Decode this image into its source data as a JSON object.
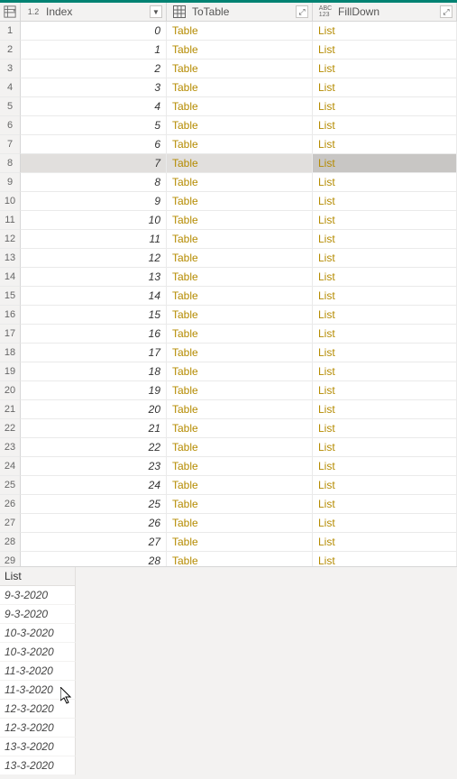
{
  "columns": {
    "index": {
      "label": "Index",
      "type_icon": "1.2"
    },
    "totable": {
      "label": "ToTable",
      "type_icon": "table"
    },
    "filldown": {
      "label": "FillDown",
      "type_icon": "ABC123"
    }
  },
  "rows": [
    {
      "n": 1,
      "index": "0",
      "totable": "Table",
      "filldown": "List"
    },
    {
      "n": 2,
      "index": "1",
      "totable": "Table",
      "filldown": "List"
    },
    {
      "n": 3,
      "index": "2",
      "totable": "Table",
      "filldown": "List"
    },
    {
      "n": 4,
      "index": "3",
      "totable": "Table",
      "filldown": "List"
    },
    {
      "n": 5,
      "index": "4",
      "totable": "Table",
      "filldown": "List"
    },
    {
      "n": 6,
      "index": "5",
      "totable": "Table",
      "filldown": "List"
    },
    {
      "n": 7,
      "index": "6",
      "totable": "Table",
      "filldown": "List"
    },
    {
      "n": 8,
      "index": "7",
      "totable": "Table",
      "filldown": "List",
      "selected": true
    },
    {
      "n": 9,
      "index": "8",
      "totable": "Table",
      "filldown": "List"
    },
    {
      "n": 10,
      "index": "9",
      "totable": "Table",
      "filldown": "List"
    },
    {
      "n": 11,
      "index": "10",
      "totable": "Table",
      "filldown": "List"
    },
    {
      "n": 12,
      "index": "11",
      "totable": "Table",
      "filldown": "List"
    },
    {
      "n": 13,
      "index": "12",
      "totable": "Table",
      "filldown": "List"
    },
    {
      "n": 14,
      "index": "13",
      "totable": "Table",
      "filldown": "List"
    },
    {
      "n": 15,
      "index": "14",
      "totable": "Table",
      "filldown": "List"
    },
    {
      "n": 16,
      "index": "15",
      "totable": "Table",
      "filldown": "List"
    },
    {
      "n": 17,
      "index": "16",
      "totable": "Table",
      "filldown": "List"
    },
    {
      "n": 18,
      "index": "17",
      "totable": "Table",
      "filldown": "List"
    },
    {
      "n": 19,
      "index": "18",
      "totable": "Table",
      "filldown": "List"
    },
    {
      "n": 20,
      "index": "19",
      "totable": "Table",
      "filldown": "List"
    },
    {
      "n": 21,
      "index": "20",
      "totable": "Table",
      "filldown": "List"
    },
    {
      "n": 22,
      "index": "21",
      "totable": "Table",
      "filldown": "List"
    },
    {
      "n": 23,
      "index": "22",
      "totable": "Table",
      "filldown": "List"
    },
    {
      "n": 24,
      "index": "23",
      "totable": "Table",
      "filldown": "List"
    },
    {
      "n": 25,
      "index": "24",
      "totable": "Table",
      "filldown": "List"
    },
    {
      "n": 26,
      "index": "25",
      "totable": "Table",
      "filldown": "List"
    },
    {
      "n": 27,
      "index": "26",
      "totable": "Table",
      "filldown": "List"
    },
    {
      "n": 28,
      "index": "27",
      "totable": "Table",
      "filldown": "List"
    },
    {
      "n": 29,
      "index": "28",
      "totable": "Table",
      "filldown": "List"
    }
  ],
  "preview": {
    "title": "List",
    "items": [
      "9-3-2020",
      "9-3-2020",
      "10-3-2020",
      "10-3-2020",
      "11-3-2020",
      "11-3-2020",
      "12-3-2020",
      "12-3-2020",
      "13-3-2020",
      "13-3-2020"
    ]
  }
}
